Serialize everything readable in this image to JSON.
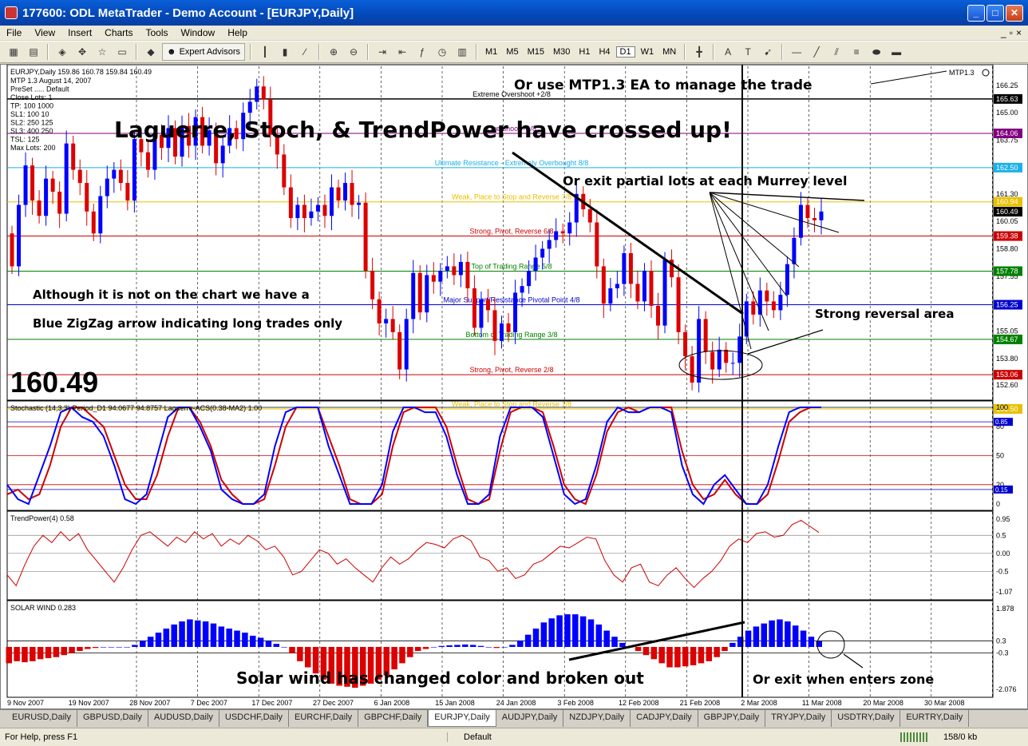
{
  "window": {
    "title": "177600: ODL MetaTrader - Demo Account - [EURJPY,Daily]",
    "min_glyph": "_",
    "max_glyph": "□",
    "close_glyph": "✕"
  },
  "menu": [
    "File",
    "View",
    "Insert",
    "Charts",
    "Tools",
    "Window",
    "Help"
  ],
  "mdi_controls": [
    "_",
    "▫",
    "×"
  ],
  "toolbar": {
    "expert_advisors_label": "Expert Advisors",
    "timeframes": [
      "M1",
      "M5",
      "M15",
      "M30",
      "H1",
      "H4",
      "D1",
      "W1",
      "MN"
    ]
  },
  "chart": {
    "symbol_line": "EURJPY,Daily  159.86 160.78 159.84 160.49",
    "info_lines": [
      "MTP 1.3  August 14, 2007",
      "PreSet ..... Default",
      "Close Lots:  1",
      "TP:  100  1000",
      "SL1:  100  10",
      "SL2:  250  125",
      "SL3:  400  250",
      "TSL:  125",
      "Max Lots:  200"
    ],
    "mtp_label": "MTP1.3",
    "big_price": "160.49",
    "murrey_levels": [
      {
        "label": "Extreme Overshoot +2/8",
        "price": 165.63,
        "color": "#000000",
        "price_bg": "#000000"
      },
      {
        "label": "Overshoot +1/8",
        "price": 164.06,
        "color": "#800080",
        "price_bg": "#800080"
      },
      {
        "label": "Ultimate Resistance - Extremely Overbought 8/8",
        "price": 162.5,
        "color": "#1ab0e8",
        "price_bg": "#1ab0e8"
      },
      {
        "label": "Weak, Place to Stop and Reverse  7/8",
        "price": 160.94,
        "color": "#e8c000",
        "price_bg": "#e8c000"
      },
      {
        "label": "Strong, Pivot, Reverse  6/8",
        "price": 159.38,
        "color": "#cc0000",
        "price_bg": "#cc0000"
      },
      {
        "label": "Top of Trading Range  5/8",
        "price": 157.78,
        "color": "#008000",
        "price_bg": "#008000"
      },
      {
        "label": "Major Support/Resistance Pivotal Point  4/8",
        "price": 156.25,
        "color": "#0000cc",
        "price_bg": "#0000cc"
      },
      {
        "label": "Bottom of Trading Range  3/8",
        "price": 154.67,
        "color": "#008000",
        "price_bg": "#008000"
      },
      {
        "label": "Strong, Pivot, Reverse  2/8",
        "price": 153.06,
        "color": "#cc0000",
        "price_bg": "#cc0000"
      },
      {
        "label": "Weak, Place to Stop and Reverse  1/8",
        "price": 151.5,
        "color": "#e8c000",
        "price_bg": "#e8c000"
      }
    ],
    "price_axis_labels": [
      "166.25",
      "165.00",
      "163.75",
      "162.50",
      "161.30",
      "160.05",
      "158.80",
      "157.55",
      "156.30",
      "155.05",
      "153.80",
      "152.60"
    ],
    "current_price_label": "160.49",
    "date_labels": [
      "9 Nov 2007",
      "19 Nov 2007",
      "28 Nov 2007",
      "7 Dec 2007",
      "17 Dec 2007",
      "27 Dec 2007",
      "6 Jan 2008",
      "15 Jan 2008",
      "24 Jan 2008",
      "3 Feb 2008",
      "12 Feb 2008",
      "21 Feb 2008",
      "2 Mar 2008",
      "11 Mar 2008",
      "20 Mar 2008",
      "30 Mar 2008"
    ],
    "annotations": {
      "headline": "Laguerre, Stoch, & TrendPower have crossed up!",
      "mtp_note": "Or use MTP1.3 EA to manage the trade",
      "murrey_note": "Or exit partial lots at each Murrey level",
      "zigzag_line1": "Although it is not on the chart we have a",
      "zigzag_line2": "Blue ZigZag arrow indicating long trades only",
      "reversal": "Strong reversal area",
      "solar_note": "Solar wind has changed color and broken out",
      "zone_note": "Or exit when enters zone"
    },
    "stoch": {
      "label": "Stochastic (14,3,3) Period_D1 94.0677 94.8757  Laguerre-ACS(0.38-MA2) 1.00",
      "axis": [
        "100",
        "80",
        "50",
        "20",
        "0"
      ],
      "markers": [
        "0.85",
        "0.15"
      ]
    },
    "trendpower": {
      "label": "TrendPower(4) 0.58",
      "axis": [
        "0.95",
        "0.5",
        "0.00",
        "-0.5",
        "-1.07"
      ]
    },
    "solar": {
      "label": "SOLAR WIND 0.283",
      "axis": [
        "1.878",
        "0.3",
        "-0.3",
        "-2.076"
      ]
    }
  },
  "tabs": [
    "EURUSD,Daily",
    "GBPUSD,Daily",
    "AUDUSD,Daily",
    "USDCHF,Daily",
    "EURCHF,Daily",
    "GBPCHF,Daily",
    "EURJPY,Daily",
    "AUDJPY,Daily",
    "NZDJPY,Daily",
    "CADJPY,Daily",
    "GBPJPY,Daily",
    "TRYJPY,Daily",
    "USDTRY,Daily",
    "EURTRY,Daily"
  ],
  "active_tab": "EURJPY,Daily",
  "status": {
    "help": "For Help, press F1",
    "profile": "Default",
    "traffic": "158/0 kb"
  },
  "colors": {
    "bull": "#0000ff",
    "bear": "#dd0000"
  }
}
